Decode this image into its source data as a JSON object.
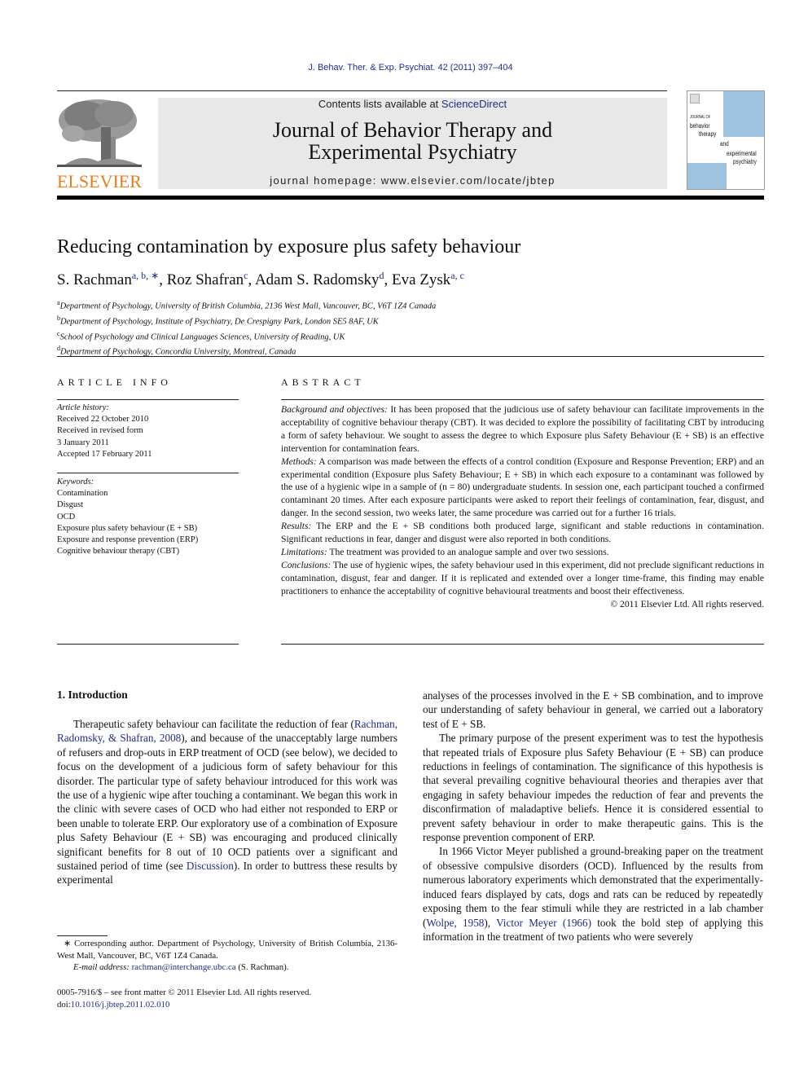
{
  "header": {
    "citation": "J. Behav. Ther. & Exp. Psychiat. 42 (2011) 397–404",
    "contents_prefix": "Contents lists available at ",
    "contents_link": "ScienceDirect",
    "journal_title_line1": "Journal of Behavior Therapy and",
    "journal_title_line2": "Experimental Psychiatry",
    "homepage": "journal homepage: www.elsevier.com/locate/jbtep",
    "publisher_logo_text": "ELSEVIER",
    "cover": {
      "line1": "JOURNAL OF",
      "line2": "behavior",
      "line3": "therapy",
      "line4": "and",
      "line5": "experimental",
      "line6": "psychiatry"
    }
  },
  "article": {
    "title": "Reducing contamination by exposure plus safety behaviour",
    "authors": [
      {
        "name": "S. Rachman",
        "sup": "a, b, ∗"
      },
      {
        "name": "Roz Shafran",
        "sup": "c"
      },
      {
        "name": "Adam S. Radomsky",
        "sup": "d"
      },
      {
        "name": "Eva Zysk",
        "sup": "a, c"
      }
    ],
    "affiliations": [
      {
        "key": "a",
        "text": "Department of Psychology, University of British Columbia, 2136 West Mall, Vancouver, BC, V6T 1Z4 Canada"
      },
      {
        "key": "b",
        "text": "Department of Psychology, Institute of Psychiatry, De Crespigny Park, London SE5 8AF, UK"
      },
      {
        "key": "c",
        "text": "School of Psychology and Clinical Languages Sciences, University of Reading, UK"
      },
      {
        "key": "d",
        "text": "Department of Psychology, Concordia University, Montreal, Canada"
      }
    ]
  },
  "article_info": {
    "heading": "ARTICLE INFO",
    "history_label": "Article history:",
    "history": [
      "Received 22 October 2010",
      "Received in revised form",
      "3 January 2011",
      "Accepted 17 February 2011"
    ],
    "keywords_label": "Keywords:",
    "keywords": [
      "Contamination",
      "Disgust",
      "OCD",
      "Exposure plus safety behaviour (E + SB)",
      "Exposure and response prevention (ERP)",
      "Cognitive behaviour therapy (CBT)"
    ]
  },
  "abstract": {
    "heading": "ABSTRACT",
    "sections": [
      {
        "label": "Background and objectives:",
        "text": " It has been proposed that the judicious use of safety behaviour can facilitate improvements in the acceptability of cognitive behaviour therapy (CBT). It was decided to explore the possibility of facilitating CBT by introducing a form of safety behaviour. We sought to assess the degree to which Exposure plus Safety Behaviour (E + SB) is an effective intervention for contamination fears."
      },
      {
        "label": "Methods:",
        "text": " A comparison was made between the effects of a control condition (Exposure and Response Prevention; ERP) and an experimental condition (Exposure plus Safety Behaviour; E + SB) in which each exposure to a contaminant was followed by the use of a hygienic wipe in a sample of (n = 80) undergraduate students. In session one, each participant touched a confirmed contaminant 20 times. After each exposure participants were asked to report their feelings of contamination, fear, disgust, and danger. In the second session, two weeks later, the same procedure was carried out for a further 16 trials."
      },
      {
        "label": "Results:",
        "text": " The ERP and the E + SB conditions both produced large, significant and stable reductions in contamination. Significant reductions in fear, danger and disgust were also reported in both conditions."
      },
      {
        "label": "Limitations:",
        "text": " The treatment was provided to an analogue sample and over two sessions."
      },
      {
        "label": "Conclusions:",
        "text": " The use of hygienic wipes, the safety behaviour used in this experiment, did not preclude significant reductions in contamination, disgust, fear and danger. If it is replicated and extended over a longer time-frame, this finding may enable practitioners to enhance the acceptability of cognitive behavioural treatments and boost their effectiveness."
      }
    ],
    "copyright": "© 2011 Elsevier Ltd. All rights reserved."
  },
  "body": {
    "section_heading": "1.  Introduction",
    "left": {
      "p1_a": "Therapeutic safety behaviour can facilitate the reduction of fear (",
      "p1_link1": "Rachman, Radomsky, & Shafran, 2008",
      "p1_b": "), and because of the unacceptably large numbers of refusers and drop-outs in ERP treatment of OCD (see below), we decided to focus on the development of a judicious form of safety behaviour for this disorder. The particular type of safety behaviour introduced for this work was the use of a hygienic wipe after touching a contaminant. We began this work in the clinic with severe cases of OCD who had either not responded to ERP or been unable to tolerate ERP. Our exploratory use of a combination of Exposure plus Safety Behaviour (E + SB) was encouraging and produced clinically significant benefits for 8 out of 10 OCD patients over a significant and sustained period of time (see ",
      "p1_link2": "Discussion",
      "p1_c": "). In order to buttress these results by experimental"
    },
    "right": {
      "p0": "analyses of the processes involved in the E + SB combination, and to improve our understanding of safety behaviour in general, we carried out a laboratory test of E + SB.",
      "p2": "The primary purpose of the present experiment was to test the hypothesis that repeated trials of Exposure plus Safety Behaviour (E + SB) can produce reductions in feelings of contamination. The significance of this hypothesis is that several prevailing cognitive behavioural theories and therapies aver that engaging in safety behaviour impedes the reduction of fear and prevents the disconfirmation of maladaptive beliefs. Hence it is considered essential to prevent safety behaviour in order to make therapeutic gains. This is the response prevention component of ERP.",
      "p3_a": "In 1966 Victor Meyer published a ground-breaking paper on the treatment of obsessive compulsive disorders (OCD). Influenced by the results from numerous laboratory experiments which demonstrated that the experimentally-induced fears displayed by cats, dogs and rats can be reduced by repeatedly exposing them to the fear stimuli while they are restricted in a lab chamber (",
      "p3_link1": "Wolpe, 1958",
      "p3_b": "), ",
      "p3_link2": "Victor Meyer (1966)",
      "p3_c": " took the bold step of applying this information in the treatment of two patients who were severely"
    }
  },
  "footnote": {
    "corresponding": "∗ Corresponding author. Department of Psychology, University of British Columbia, 2136-West Mall, Vancouver, BC, V6T 1Z4 Canada.",
    "email_label": "E-mail address:",
    "email": "rachman@interchange.ubc.ca",
    "email_suffix": " (S. Rachman).",
    "front_matter": "0005-7916/$ – see front matter © 2011 Elsevier Ltd. All rights reserved.",
    "doi_label": "doi:",
    "doi": "10.1016/j.jbtep.2011.02.010"
  }
}
